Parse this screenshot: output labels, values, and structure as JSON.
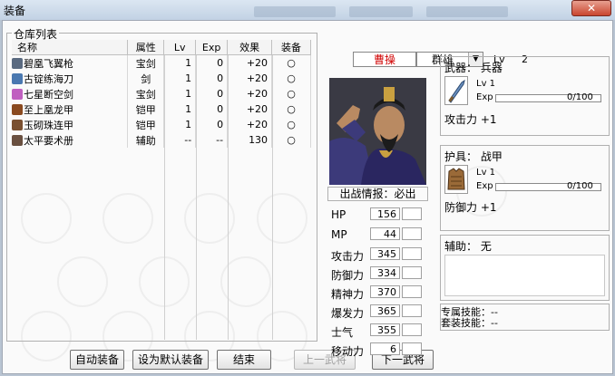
{
  "window": {
    "title": "装备",
    "close_glyph": "✕"
  },
  "warehouse": {
    "legend": "仓库列表",
    "columns": [
      "名称",
      "属性",
      "Lv",
      "Exp",
      "效果",
      "装备"
    ],
    "items": [
      {
        "name": "碧凰飞翼枪",
        "attr": "宝剑",
        "lv": "1",
        "exp": "0",
        "effect": "+20",
        "equip": "○",
        "icon_color": "#5a6a80"
      },
      {
        "name": "古锭练海刀",
        "attr": "剑",
        "lv": "1",
        "exp": "0",
        "effect": "+20",
        "equip": "○",
        "icon_color": "#4a78b0"
      },
      {
        "name": "七星断空剑",
        "attr": "宝剑",
        "lv": "1",
        "exp": "0",
        "effect": "+20",
        "equip": "○",
        "icon_color": "#c060c0"
      },
      {
        "name": "至上凰龙甲",
        "attr": "铠甲",
        "lv": "1",
        "exp": "0",
        "effect": "+20",
        "equip": "○",
        "icon_color": "#8a4a20"
      },
      {
        "name": "玉砌珠连甲",
        "attr": "铠甲",
        "lv": "1",
        "exp": "0",
        "effect": "+20",
        "equip": "○",
        "icon_color": "#7a5030"
      },
      {
        "name": "太平要术册",
        "attr": "辅助",
        "lv": "--",
        "exp": "--",
        "effect": "130",
        "equip": "○",
        "icon_color": "#6a5040"
      }
    ]
  },
  "buttons": {
    "auto_equip": "自动装备",
    "set_default": "设为默认装备",
    "finish": "结束",
    "prev_general": "上一武将",
    "next_general": "下一武将"
  },
  "hero": {
    "name": "曹操",
    "group_selected": "群雄",
    "level_label": "Lv",
    "level_value": "2",
    "sortie_info": "出战情报：必出"
  },
  "stats": [
    {
      "label": "HP",
      "value": "156"
    },
    {
      "label": "MP",
      "value": "44"
    },
    {
      "label": "攻击力",
      "value": "345"
    },
    {
      "label": "防御力",
      "value": "334"
    },
    {
      "label": "精神力",
      "value": "370"
    },
    {
      "label": "爆发力",
      "value": "365"
    },
    {
      "label": "士气",
      "value": "355"
    },
    {
      "label": "移动力",
      "value": "6"
    }
  ],
  "weapon": {
    "header": "武器：  兵器",
    "lv": "Lv  1",
    "exp_label": "Exp",
    "exp_value": "0/100",
    "exp_fraction": 0,
    "bonus": "攻击力 +1"
  },
  "armor": {
    "header": "护具：  战甲",
    "lv": "Lv  1",
    "exp_label": "Exp",
    "exp_value": "0/100",
    "exp_fraction": 0,
    "bonus": "防御力 +1"
  },
  "accessory": {
    "header": "辅助：  无"
  },
  "skills": {
    "exclusive": "专属技能：--",
    "set": "套装技能：--"
  }
}
